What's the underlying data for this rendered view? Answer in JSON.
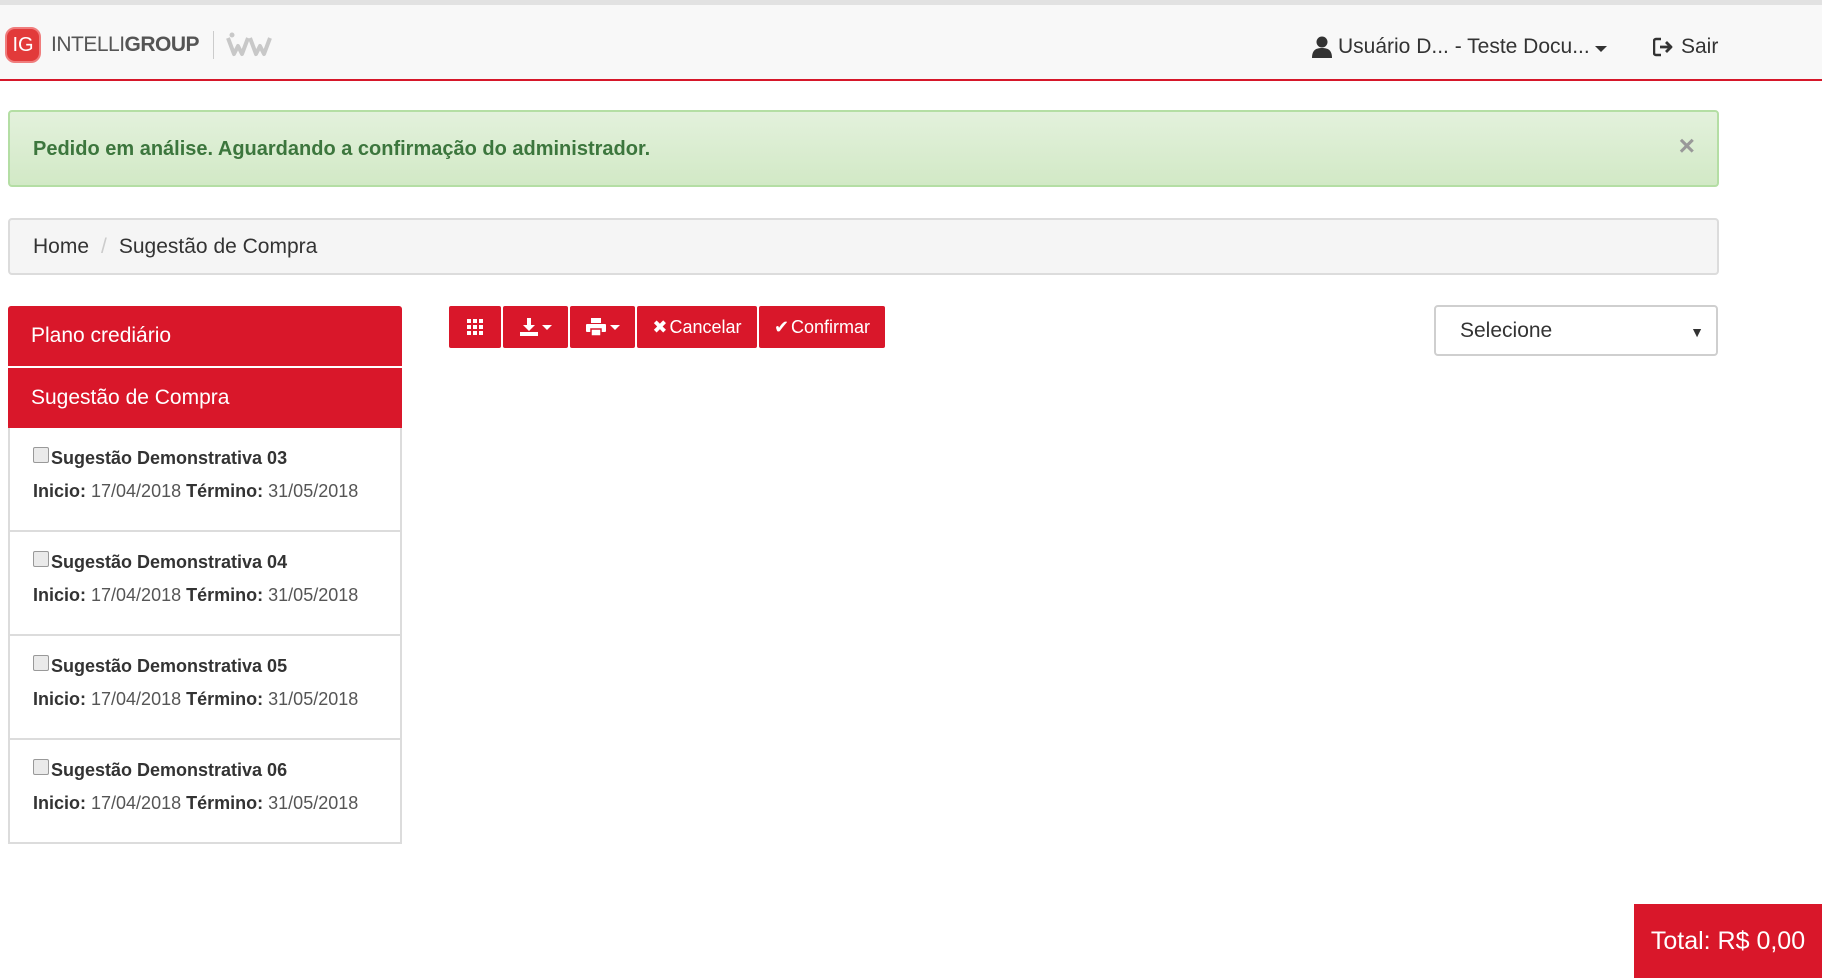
{
  "navbar": {
    "brand_initials": "IG",
    "brand_name_light": "INTELLI",
    "brand_name_bold": "GROUP",
    "brand_mark_icon": "wi-logo-mark",
    "user_icon": "user-icon",
    "user_label": "Usuário D... - Teste Docu...",
    "logout_icon": "sign-out-icon",
    "logout_label": "Sair"
  },
  "alert": {
    "message": "Pedido em análise. Aguardando a confirmação do administrador.",
    "close_label": "×"
  },
  "breadcrumb": {
    "separator": "/",
    "items": [
      "Home",
      "Sugestão de Compra"
    ]
  },
  "sidebar": {
    "headers": [
      "Plano crediário",
      "Sugestão de Compra"
    ],
    "start_label": "Inicio:",
    "end_label": "Término:",
    "items": [
      {
        "title": "Sugestão Demonstrativa 03",
        "start": "17/04/2018",
        "end": "31/05/2018",
        "checked": false
      },
      {
        "title": "Sugestão Demonstrativa 04",
        "start": "17/04/2018",
        "end": "31/05/2018",
        "checked": false
      },
      {
        "title": "Sugestão Demonstrativa 05",
        "start": "17/04/2018",
        "end": "31/05/2018",
        "checked": false
      },
      {
        "title": "Sugestão Demonstrativa 06",
        "start": "17/04/2018",
        "end": "31/05/2018",
        "checked": false
      }
    ]
  },
  "toolbar": {
    "grid_icon": "grid-icon",
    "download_icon": "download-icon",
    "print_icon": "print-icon",
    "cancel_icon": "✖",
    "cancel_label": "Cancelar",
    "confirm_icon": "✔",
    "confirm_label": "Confirmar"
  },
  "select": {
    "selected": "Selecione",
    "arrow": "▼"
  },
  "total": {
    "label": "Total: R$ 0,00"
  },
  "colors": {
    "primary": "#d9172a",
    "alert_bg": "#dff0d8",
    "alert_text": "#3c763d",
    "breadcrumb_bg": "#f5f5f5"
  }
}
